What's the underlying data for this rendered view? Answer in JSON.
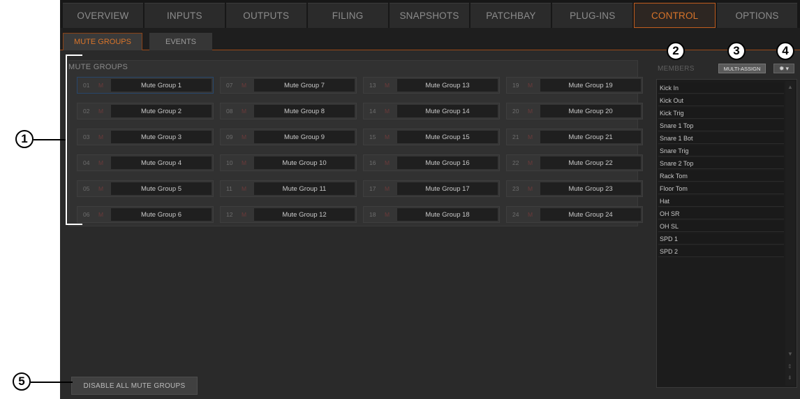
{
  "nav": {
    "tabs": [
      "OVERVIEW",
      "INPUTS",
      "OUTPUTS",
      "FILING",
      "SNAPSHOTS",
      "PATCHBAY",
      "PLUG-INS",
      "CONTROL",
      "OPTIONS"
    ],
    "active": "CONTROL"
  },
  "subnav": {
    "mute_groups": "MUTE GROUPS",
    "events": "EVENTS"
  },
  "mute_groups": {
    "title": "MUTE GROUPS",
    "m_label": "M",
    "groups": [
      {
        "num": "01",
        "name": "Mute Group 1"
      },
      {
        "num": "02",
        "name": "Mute Group 2"
      },
      {
        "num": "03",
        "name": "Mute Group 3"
      },
      {
        "num": "04",
        "name": "Mute Group 4"
      },
      {
        "num": "05",
        "name": "Mute Group 5"
      },
      {
        "num": "06",
        "name": "Mute Group 6"
      },
      {
        "num": "07",
        "name": "Mute Group 7"
      },
      {
        "num": "08",
        "name": "Mute Group 8"
      },
      {
        "num": "09",
        "name": "Mute Group 9"
      },
      {
        "num": "10",
        "name": "Mute Group 10"
      },
      {
        "num": "11",
        "name": "Mute Group 11"
      },
      {
        "num": "12",
        "name": "Mute Group 12"
      },
      {
        "num": "13",
        "name": "Mute Group 13"
      },
      {
        "num": "14",
        "name": "Mute Group 14"
      },
      {
        "num": "15",
        "name": "Mute Group 15"
      },
      {
        "num": "16",
        "name": "Mute Group 16"
      },
      {
        "num": "17",
        "name": "Mute Group 17"
      },
      {
        "num": "18",
        "name": "Mute Group 18"
      },
      {
        "num": "19",
        "name": "Mute Group 19"
      },
      {
        "num": "20",
        "name": "Mute Group 20"
      },
      {
        "num": "21",
        "name": "Mute Group 21"
      },
      {
        "num": "22",
        "name": "Mute Group 22"
      },
      {
        "num": "23",
        "name": "Mute Group 23"
      },
      {
        "num": "24",
        "name": "Mute Group 24"
      }
    ]
  },
  "members": {
    "label": "MEMBERS",
    "multi_assign": "MULTI-ASSIGN",
    "items": [
      "Kick In",
      "Kick Out",
      "Kick Trig",
      "Snare 1 Top",
      "Snare 1 Bot",
      "Snare Trig",
      "Snare 2 Top",
      "Rack Tom",
      "Floor Tom",
      "Hat",
      "OH SR",
      "OH SL",
      "SPD 1",
      "SPD 2"
    ]
  },
  "disable_all": "DISABLE ALL MUTE GROUPS",
  "callouts": [
    "1",
    "2",
    "3",
    "4",
    "5"
  ],
  "colors": {
    "accent": "#d8742a",
    "background": "#2a2a2a"
  }
}
